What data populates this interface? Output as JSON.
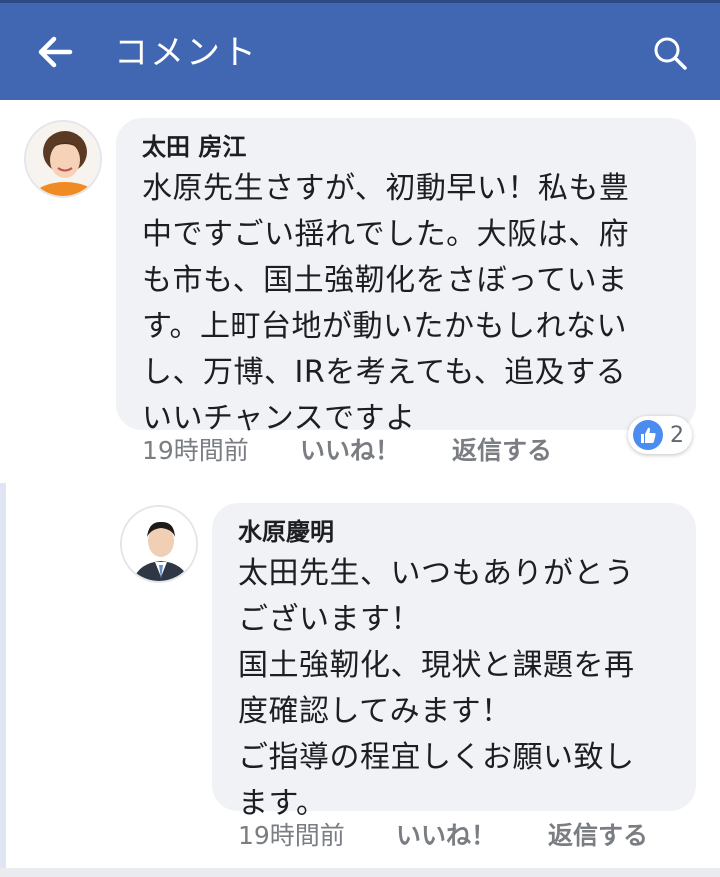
{
  "header": {
    "title": "コメント",
    "back_icon": "arrow-left-icon",
    "search_icon": "search-icon",
    "bar_color": "#4267b2"
  },
  "comments": [
    {
      "author": "太田 房江",
      "text": "水原先生さすが、初動早い！私も豊\n中ですごい揺れでした。大阪は、府\nも市も、国土強靭化をさぼっていま\nす。上町台地が動いたかもしれない\nし、万博、IRを考えても、追及する\nいいチャンスですよ",
      "time": "19時間前",
      "like_label": "いいね！",
      "reply_label": "返信する",
      "reaction_count": "2",
      "reaction_icon": "thumbs-up-icon"
    },
    {
      "author": "水原慶明",
      "text": "太田先生、いつもありがとう\nございます！\n国土強靭化、現状と課題を再\n度確認してみます！\nご指導の程宜しくお願い致し\nます。",
      "time": "19時間前",
      "like_label": "いいね！",
      "reply_label": "返信する"
    }
  ]
}
